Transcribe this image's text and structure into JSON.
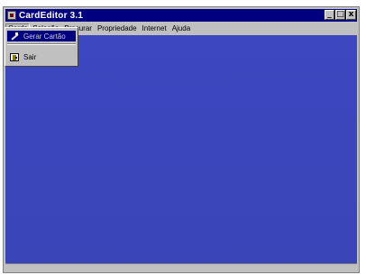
{
  "window": {
    "title": "CardEditor 3.1",
    "controls": [
      "_",
      "□",
      "x"
    ]
  },
  "menubar": {
    "items": [
      {
        "label": "Cards",
        "active": true
      },
      {
        "label": "Seleção"
      },
      {
        "label": "Procurar"
      },
      {
        "label": "Propriedade"
      },
      {
        "label": "Internet"
      },
      {
        "label": "Ajuda"
      }
    ]
  },
  "cards_menu": {
    "items": [
      {
        "label": "Gerar Cartão",
        "icon": "magic-wand-icon",
        "highlighted": true
      },
      {
        "label": "Sair",
        "icon": "exit-door-icon"
      }
    ]
  },
  "colors": {
    "titlebar": "#000080",
    "client_area": "#3a45b8",
    "chrome": "#c0c0c0",
    "highlight": "#000080"
  }
}
